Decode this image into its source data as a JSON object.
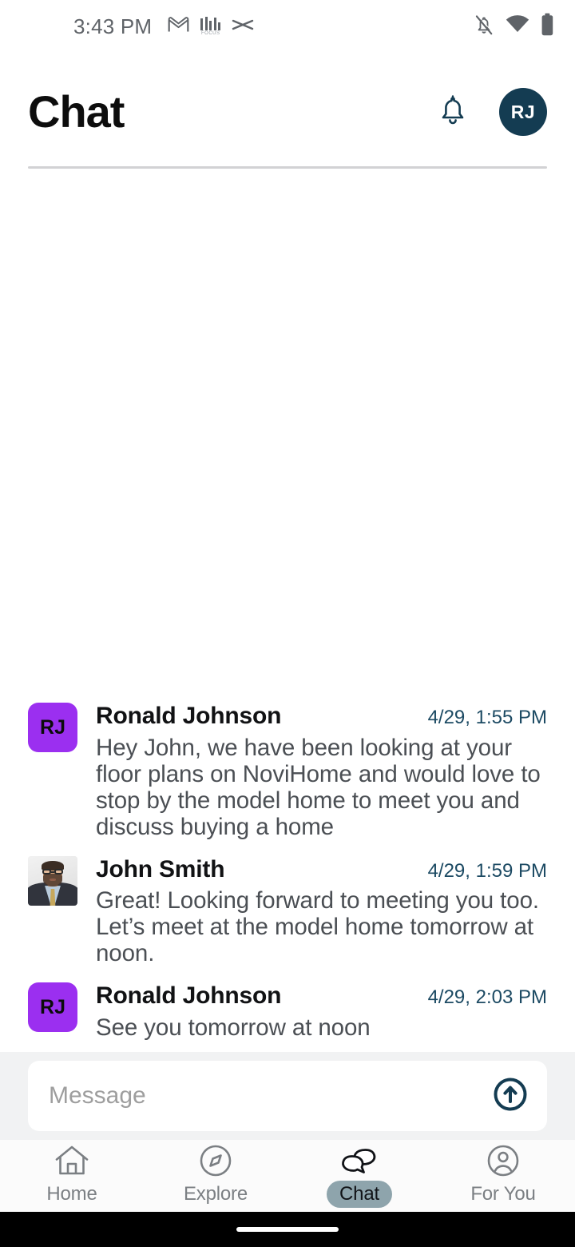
{
  "status_bar": {
    "time": "3:43 PM",
    "left_icons": [
      {
        "name": "gmail-icon",
        "label": "M"
      },
      {
        "name": "focus-icon",
        "label": "FOCUS"
      },
      {
        "name": "zigzag-icon",
        "label": "zigzag"
      }
    ],
    "right_icons": [
      {
        "name": "notifications-off-icon",
        "label": "notifications-off"
      },
      {
        "name": "wifi-icon",
        "label": "wifi"
      },
      {
        "name": "battery-icon",
        "label": "battery-full"
      }
    ]
  },
  "header": {
    "title": "Chat",
    "notification_icon": "bell-icon",
    "avatar_initials": "RJ",
    "avatar_color": "#143c52"
  },
  "messages": [
    {
      "sender": "Ronald Johnson",
      "timestamp": "4/29, 1:55 PM",
      "text": "Hey John, we have been looking at your floor plans on NoviHome and would love to stop by the model home to meet you and discuss buying a home",
      "avatar_type": "initials",
      "avatar_initials": "RJ",
      "avatar_color": "#9b2ff0"
    },
    {
      "sender": "John Smith",
      "timestamp": "4/29, 1:59 PM",
      "text": "Great!  Looking forward to meeting you too. Let’s meet at the model home tomorrow at noon.",
      "avatar_type": "photo",
      "avatar_initials": "JS",
      "avatar_color": "#e6e7e8"
    },
    {
      "sender": "Ronald Johnson",
      "timestamp": "4/29, 2:03 PM",
      "text": "See you tomorrow at noon",
      "avatar_type": "initials",
      "avatar_initials": "RJ",
      "avatar_color": "#9b2ff0"
    }
  ],
  "composer": {
    "placeholder": "Message",
    "value": "",
    "send_icon": "send-arrow-up-icon"
  },
  "bottom_nav": {
    "items": [
      {
        "label": "Home",
        "icon": "home-icon",
        "active": false
      },
      {
        "label": "Explore",
        "icon": "compass-icon",
        "active": false
      },
      {
        "label": "Chat",
        "icon": "chat-bubbles-icon",
        "active": true
      },
      {
        "label": "For You",
        "icon": "person-circle-icon",
        "active": false
      }
    ],
    "active_pill_color": "#8ea4ac"
  },
  "colors": {
    "accent_navy": "#143c52",
    "timestamp": "#1c4a63",
    "purple_avatar": "#9b2ff0",
    "composer_bg": "#f1f2f3"
  }
}
